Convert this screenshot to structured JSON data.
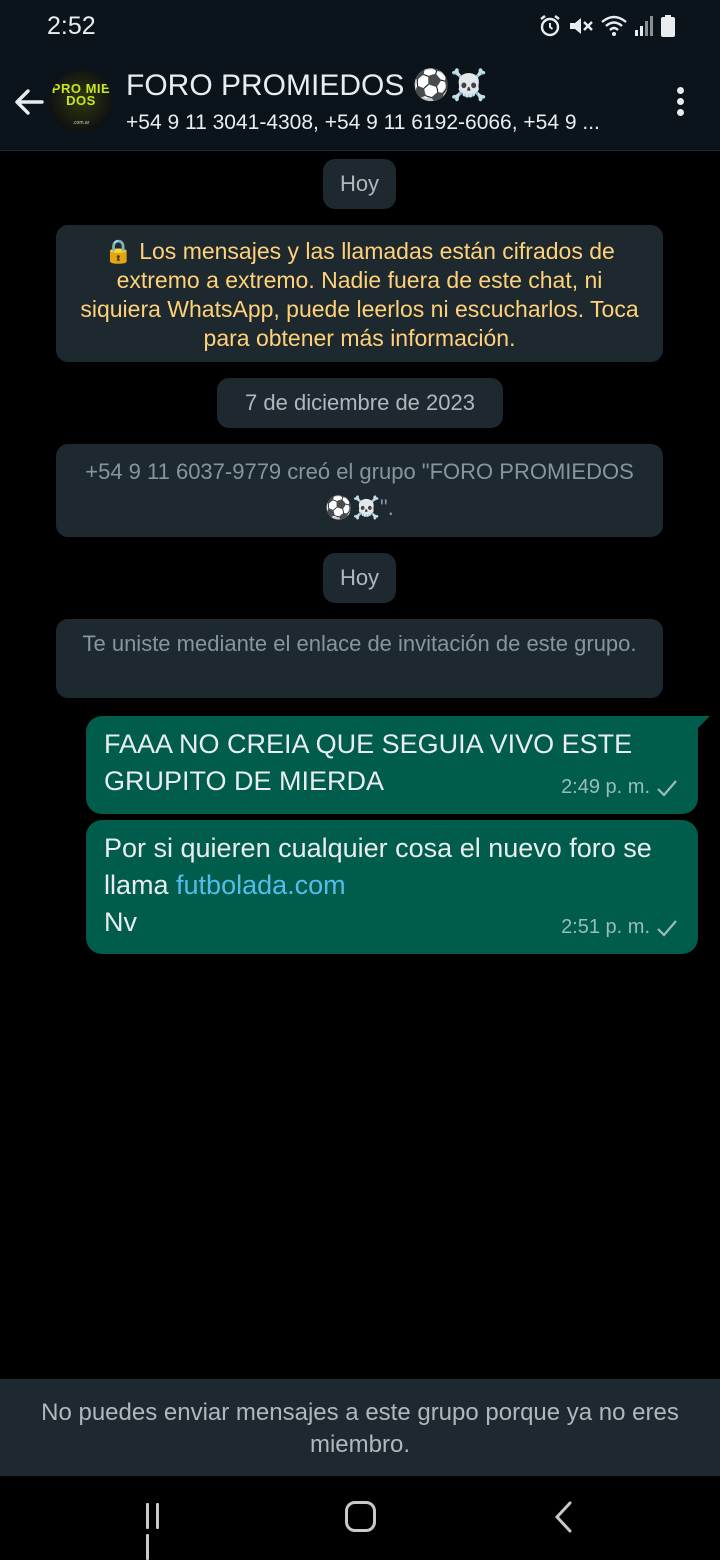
{
  "status_bar": {
    "time": "2:52",
    "icons": [
      "alarm-icon",
      "mute-icon",
      "wifi-icon",
      "signal-icon",
      "battery-icon"
    ]
  },
  "header": {
    "title": "FORO PROMIEDOS ⚽☠️",
    "subtitle": "+54 9 11 3041-4308, +54 9 11 6192-6066, +54 9 ...",
    "avatar_text": "PRO MIE DOS",
    "avatar_sub": ".com.ar"
  },
  "chat": {
    "date_today_1": "Hoy",
    "encryption_notice": "🔒 Los mensajes y las llamadas están cifrados de extremo a extremo. Nadie fuera de este chat, ni siquiera WhatsApp, puede leerlos ni escucharlos. Toca para obtener más información.",
    "date_dec": "7 de diciembre de 2023",
    "group_created": "+54 9 11 6037-9779 creó el grupo \"FORO PROMIEDOS ⚽☠️\".",
    "date_today_2": "Hoy",
    "joined_notice": "Te uniste mediante el enlace de invitación de este grupo.",
    "messages": [
      {
        "text": "FAAA NO CREIA QUE SEGUIA VIVO ESTE GRUPITO DE MIERDA",
        "time": "2:49 p. m."
      },
      {
        "text_before": "Por si quieren cualquier cosa el nuevo foro se llama ",
        "link": "futbolada.com",
        "text_after": "Nv",
        "time": "2:51 p. m."
      }
    ]
  },
  "footer": {
    "notice": "No puedes enviar mensajes a este grupo porque ya no eres miembro."
  },
  "colors": {
    "background": "#000000",
    "header": "#0b141a",
    "outgoing_bubble": "#005c4b",
    "system_chip": "#1d282f",
    "encryption_text": "#ffd279",
    "link": "#53bdeb"
  }
}
